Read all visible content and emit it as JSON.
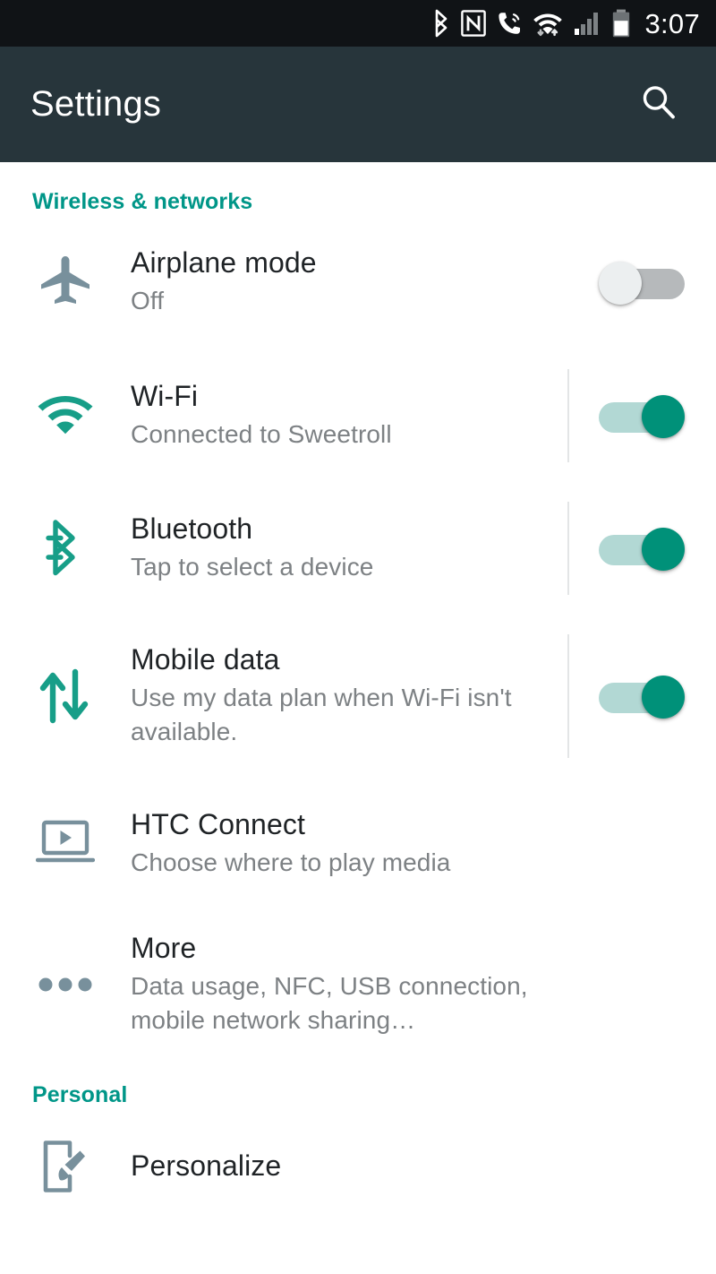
{
  "statusbar": {
    "time": "3:07",
    "icons": [
      {
        "name": "bluetooth-icon",
        "label": "Bluetooth"
      },
      {
        "name": "nfc-icon",
        "label": "NFC"
      },
      {
        "name": "call-icon",
        "label": "Call in progress"
      },
      {
        "name": "wifi-icon",
        "label": "Wi-Fi with data transfer"
      },
      {
        "name": "cellular-signal-icon",
        "label": "Cellular signal"
      },
      {
        "name": "battery-icon",
        "label": "Battery"
      }
    ]
  },
  "toolbar": {
    "title": "Settings",
    "search_icon": "search-icon"
  },
  "colors": {
    "accent_teal": "#009688",
    "toolbar_bg": "#27353b",
    "statusbar_bg": "#101316",
    "switch_on_thumb": "#009179",
    "switch_on_track": "#b2d8d4",
    "switch_off_thumb": "#eceff0",
    "switch_off_track": "#b6b9bb",
    "title_text": "#1f2326",
    "sub_text": "#7d8184",
    "gray_icon": "#78909c"
  },
  "sections": [
    {
      "header": "Wireless & networks",
      "items": [
        {
          "icon": "airplane-icon",
          "title": "Airplane mode",
          "subtitle": "Off",
          "switch": "off"
        },
        {
          "icon": "wifi-icon",
          "title": "Wi-Fi",
          "subtitle": "Connected to Sweetroll",
          "switch": "on"
        },
        {
          "icon": "bluetooth-icon",
          "title": "Bluetooth",
          "subtitle": "Tap to select a device",
          "switch": "on"
        },
        {
          "icon": "mobile-data-icon",
          "title": "Mobile data",
          "subtitle": "Use my data plan when Wi-Fi isn't available.",
          "switch": "on"
        },
        {
          "icon": "htc-connect-icon",
          "title": "HTC Connect",
          "subtitle": "Choose where to play media",
          "switch": "none"
        },
        {
          "icon": "more-dots-icon",
          "title": "More",
          "subtitle": "Data usage, NFC, USB connection, mobile network sharing…",
          "switch": "none"
        }
      ]
    },
    {
      "header": "Personal",
      "items": [
        {
          "icon": "personalize-icon",
          "title": "Personalize",
          "subtitle": "",
          "switch": "none"
        }
      ]
    }
  ]
}
